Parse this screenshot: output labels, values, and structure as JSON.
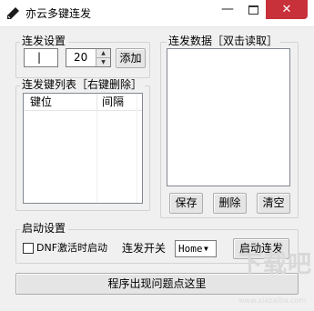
{
  "window": {
    "title": "亦云多键连发",
    "minimize_glyph": "—",
    "close_glyph": "✕",
    "icon": "pen-icon"
  },
  "settings": {
    "legend": "连发设置",
    "key_value": "|",
    "interval_value": "20",
    "add_label": "添加",
    "spin_up": "▲",
    "spin_down": "▼"
  },
  "key_list": {
    "legend": "连发键列表［右键删除］",
    "col_key": "键位",
    "col_interval": "间隔"
  },
  "data_panel": {
    "legend": "连发数据［双击读取］",
    "save_label": "保存",
    "delete_label": "删除",
    "clear_label": "清空"
  },
  "startup": {
    "legend": "启动设置",
    "dnf_checkbox_label": "DNF激活时启动",
    "dnf_checked": false,
    "toggle_label": "连发开关",
    "toggle_key_value": "Home",
    "dropdown_arrow": "▼",
    "start_label": "启动连发"
  },
  "footer": {
    "problem_label": "程序出现问题点这里"
  },
  "watermark": {
    "text": "下载吧",
    "sub": "www.xiazaiba.com"
  },
  "colors": {
    "close_button": "#c8303a",
    "group_border": "#d3d3d3",
    "window_bg": "#f0f0f0"
  }
}
